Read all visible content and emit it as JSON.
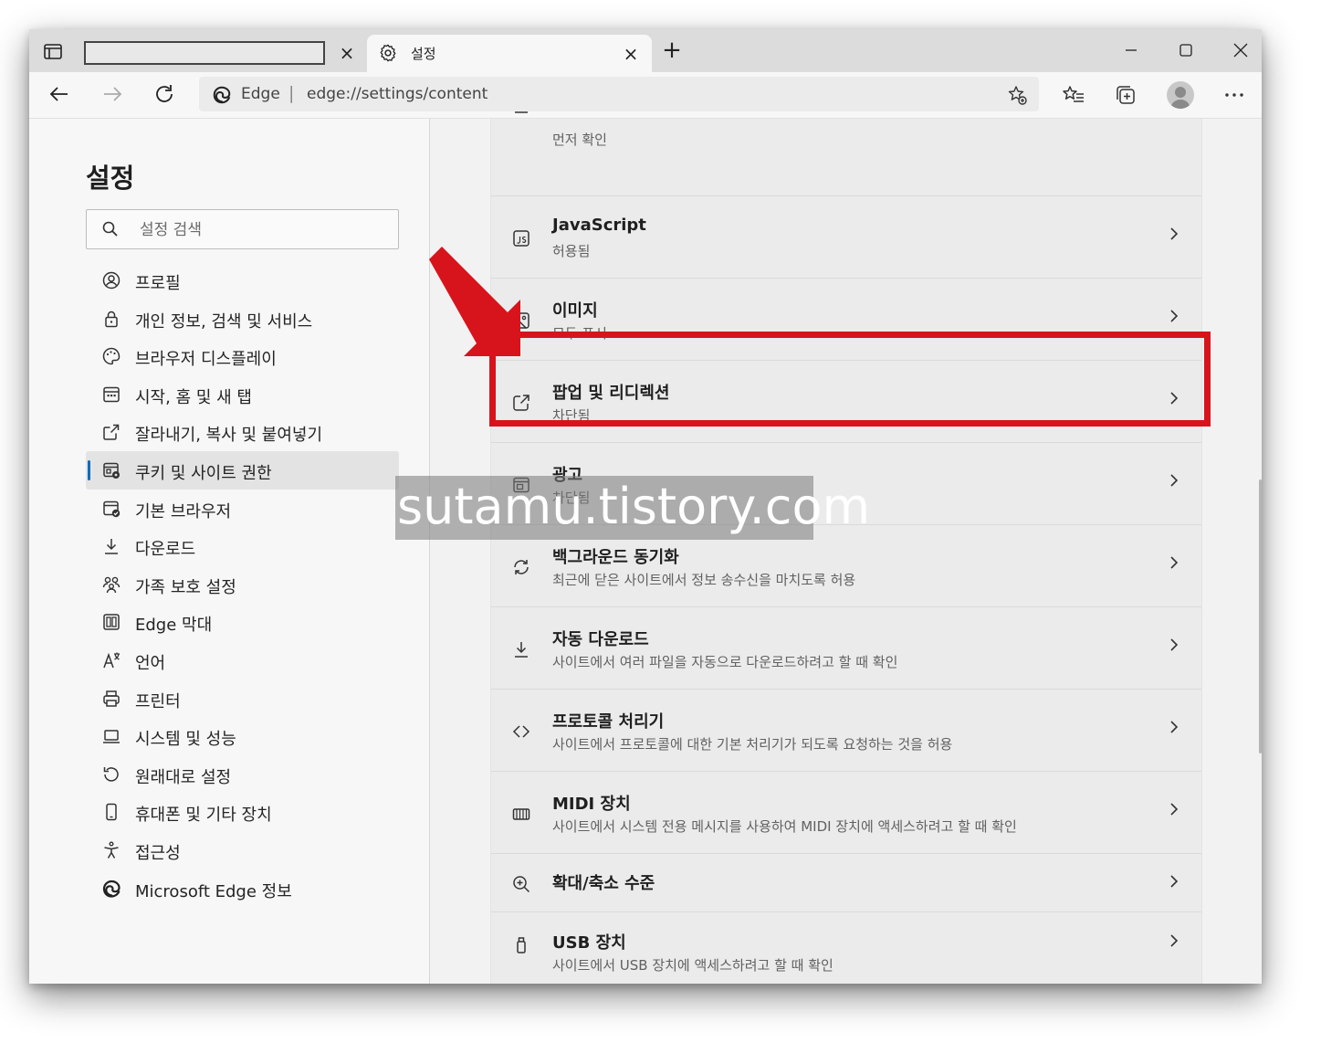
{
  "tabs": {
    "inactive_title": "",
    "active_label": "설정"
  },
  "addressbar": {
    "site_label": "Edge",
    "separator": "|",
    "url": "edge://settings/content"
  },
  "sidebar": {
    "title": "설정",
    "search_placeholder": "설정 검색",
    "items": [
      {
        "label": "프로필",
        "icon": "profile-icon"
      },
      {
        "label": "개인 정보, 검색 및 서비스",
        "icon": "lock-icon"
      },
      {
        "label": "브라우저 디스플레이",
        "icon": "palette-icon"
      },
      {
        "label": "시작, 홈 및 새 탭",
        "icon": "start-page-icon"
      },
      {
        "label": "잘라내기, 복사 및 붙여넣기",
        "icon": "share-icon"
      },
      {
        "label": "쿠키 및 사이트 권한",
        "icon": "site-permissions-icon",
        "active": true
      },
      {
        "label": "기본 브라우저",
        "icon": "default-browser-icon"
      },
      {
        "label": "다운로드",
        "icon": "download-icon"
      },
      {
        "label": "가족 보호 설정",
        "icon": "family-icon"
      },
      {
        "label": "Edge 막대",
        "icon": "edge-bar-icon"
      },
      {
        "label": "언어",
        "icon": "language-icon"
      },
      {
        "label": "프린터",
        "icon": "printer-icon"
      },
      {
        "label": "시스템 및 성능",
        "icon": "laptop-icon"
      },
      {
        "label": "원래대로 설정",
        "icon": "reset-icon"
      },
      {
        "label": "휴대폰 및 기타 장치",
        "icon": "phone-icon"
      },
      {
        "label": "접근성",
        "icon": "accessibility-icon"
      },
      {
        "label": "Microsoft Edge 정보",
        "icon": "edge-logo-icon"
      }
    ]
  },
  "content": {
    "rows": [
      {
        "title": "",
        "sub": "먼저 확인",
        "icon": "partial-icon"
      },
      {
        "title": "JavaScript",
        "sub": "허용됨",
        "icon": "javascript-icon"
      },
      {
        "title": "이미지",
        "sub": "모두 표시",
        "icon": "image-icon"
      },
      {
        "title": "팝업 및 리디렉션",
        "sub": "차단됨",
        "icon": "popup-icon"
      },
      {
        "title": "광고",
        "sub": "차단됨",
        "icon": "ads-icon"
      },
      {
        "title": "백그라운드 동기화",
        "sub": "최근에 닫은 사이트에서 정보 송수신을 마치도록 허용",
        "icon": "sync-icon"
      },
      {
        "title": "자동 다운로드",
        "sub": "사이트에서 여러 파일을 자동으로 다운로드하려고 할 때 확인",
        "icon": "download-icon"
      },
      {
        "title": "프로토콜 처리기",
        "sub": "사이트에서 프로토콜에 대한 기본 처리기가 되도록 요청하는 것을 허용",
        "icon": "protocol-icon"
      },
      {
        "title": "MIDI 장치",
        "sub": "사이트에서 시스템 전용 메시지를 사용하여 MIDI 장치에 액세스하려고 할 때 확인",
        "icon": "midi-icon"
      },
      {
        "title": "확대/축소 수준",
        "sub": "",
        "icon": "zoom-icon"
      },
      {
        "title": "USB 장치",
        "sub": "사이트에서 USB 장치에 액세스하려고 할 때 확인",
        "icon": "usb-icon"
      }
    ]
  },
  "watermark": "sutamu.tistory.com",
  "colors": {
    "highlight": "#d7141c",
    "accent": "#0f6cbd"
  }
}
